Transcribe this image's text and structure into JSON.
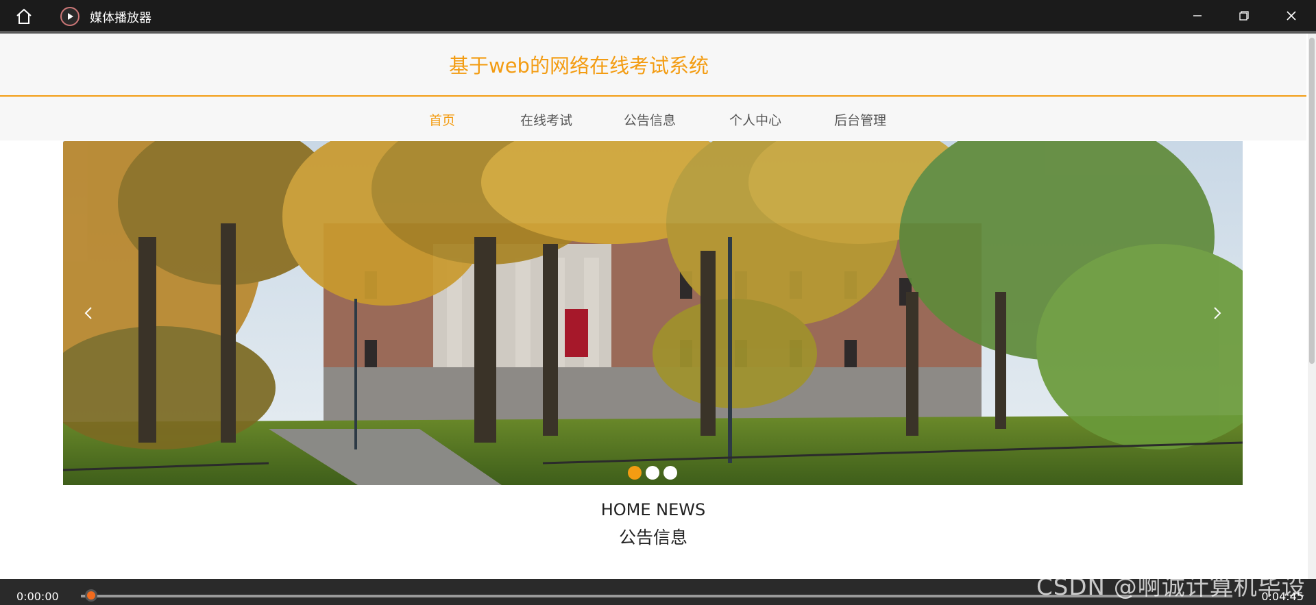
{
  "window": {
    "title": "媒体播放器"
  },
  "site": {
    "title": "基于web的网络在线考试系统",
    "nav": [
      {
        "label": "首页",
        "active": true
      },
      {
        "label": "在线考试",
        "active": false
      },
      {
        "label": "公告信息",
        "active": false
      },
      {
        "label": "个人中心",
        "active": false
      },
      {
        "label": "后台管理",
        "active": false
      }
    ],
    "carousel": {
      "slide_count": 3,
      "active_index": 0,
      "prev_icon": "chevron-left-icon",
      "next_icon": "chevron-right-icon"
    },
    "news": {
      "heading_en": "HOME NEWS",
      "heading_cn": "公告信息"
    }
  },
  "player": {
    "current_time": "0:00:00",
    "total_time": "0:04:45",
    "progress": 0.0,
    "watermark": "CSDN @啊诚计算机毕设"
  },
  "colors": {
    "accent": "#f39c12",
    "titlebar": "#1b1b1b",
    "knob": "#f26b1d"
  }
}
